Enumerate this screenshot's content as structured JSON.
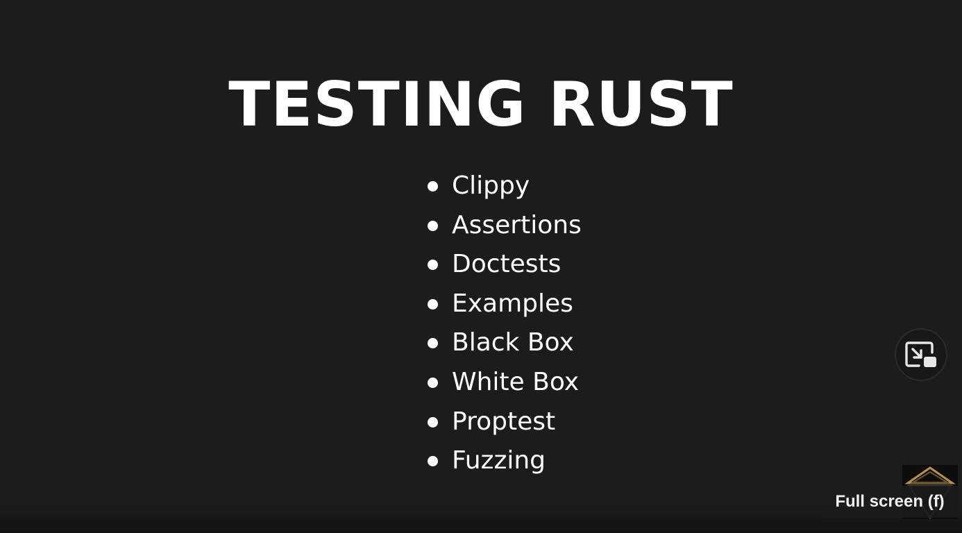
{
  "slide": {
    "title": "TESTING RUST",
    "bullets": [
      "Clippy",
      "Assertions",
      "Doctests",
      "Examples",
      "Black Box",
      "White Box",
      "Proptest",
      "Fuzzing"
    ]
  },
  "player": {
    "pip_icon": "picture-in-picture-exit-icon",
    "fullscreen_tooltip": "Full screen (f)"
  },
  "colors": {
    "background": "#1c1c1c",
    "text": "#ffffff",
    "thumb_accent": "#b8924a"
  }
}
